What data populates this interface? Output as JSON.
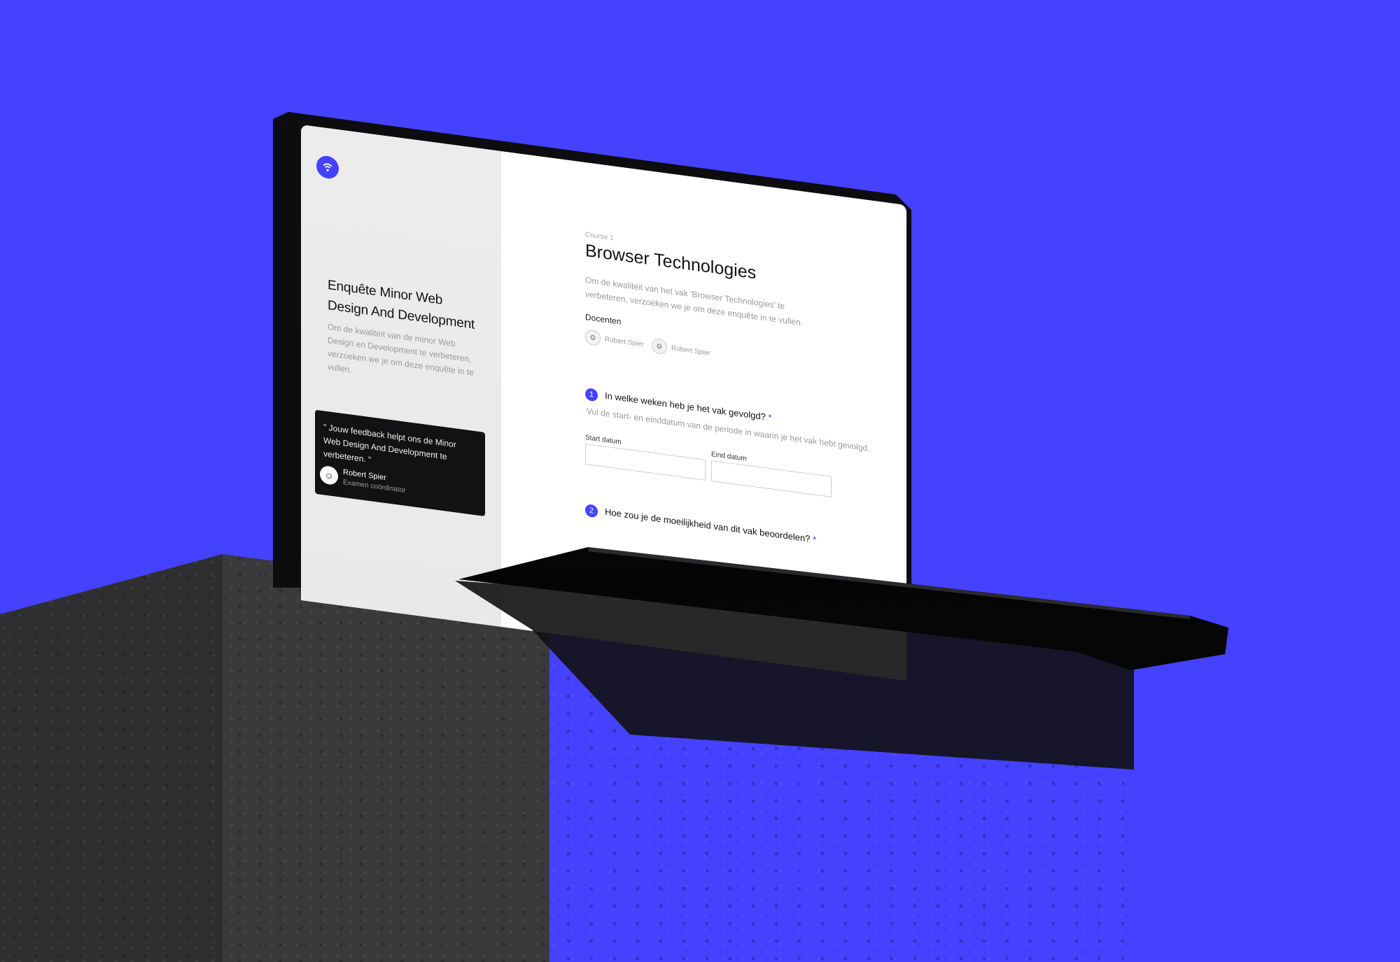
{
  "sidebar": {
    "logo_icon": "wifi-logo-icon",
    "title": "Enquête Minor Web Design And Development",
    "description": "Om de kwaliteit van de minor Web Design en Development te verbeteren, verzoeken we je om deze enquête in te vullen.",
    "quote": {
      "text": "\" Jouw feedback helpt ons de Minor Web Design And Development te verbeteren. \"",
      "name": "Robert Spier",
      "role": "Examen coördinator"
    }
  },
  "main": {
    "course_label": "Course 1",
    "course_title": "Browser Technologies",
    "course_description": "Om de kwaliteit van het vak 'Browser Technologies' te verbeteren, verzoeken we je om deze enquête in te vullen.",
    "teachers_label": "Docenten",
    "teachers": [
      {
        "name": "Robert Spier"
      },
      {
        "name": "Robert Spier"
      }
    ],
    "questions": [
      {
        "number": "1",
        "text": "In welke weken heb je het vak gevolgd?",
        "required_marker": "*",
        "hint": "Vul de start- en einddatum van de periode in waarin je het vak hebt gevolgd.",
        "fields": [
          {
            "label": "Start datum",
            "value": ""
          },
          {
            "label": "Eind datum",
            "value": ""
          }
        ]
      },
      {
        "number": "2",
        "text": "Hoe zou je de moeilijkheid van dit vak beoordelen?",
        "required_marker": "*"
      }
    ]
  },
  "colors": {
    "accent": "#4542ff",
    "quote_card": "#121214",
    "sidebar_bg": "#ececec"
  }
}
